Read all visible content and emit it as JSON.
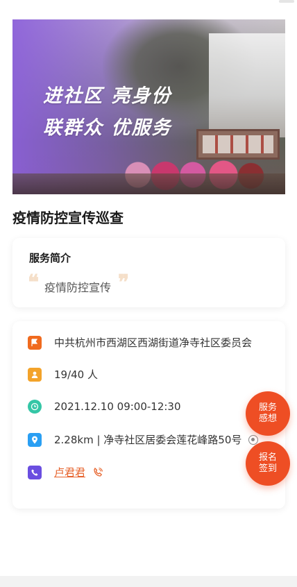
{
  "banner": {
    "line1": "进社区  亮身份",
    "line2": "联群众  优服务"
  },
  "activity": {
    "title": "疫情防控宣传巡查"
  },
  "intro": {
    "heading": "服务简介",
    "text": "疫情防控宣传",
    "open_quote": "❝",
    "close_quote": "❞"
  },
  "info": {
    "organization": "中共杭州市西湖区西湖街道净寺社区委员会",
    "participants": "19/40 人",
    "time": "2021.12.10 09:00-12:30",
    "location": "2.28km | 净寺社区居委会莲花峰路50号",
    "contact": "卢君君"
  },
  "colors": {
    "accent": "#ee4e24",
    "flag_icon": "#f06a1e",
    "person_icon": "#f3a32a",
    "clock_icon": "#34c6a6",
    "pin_icon": "#2a9ff3",
    "phone_icon": "#6a4ee0"
  },
  "fabs": {
    "feedback": [
      "服务",
      "感想"
    ],
    "signin": [
      "报名",
      "签到"
    ]
  }
}
